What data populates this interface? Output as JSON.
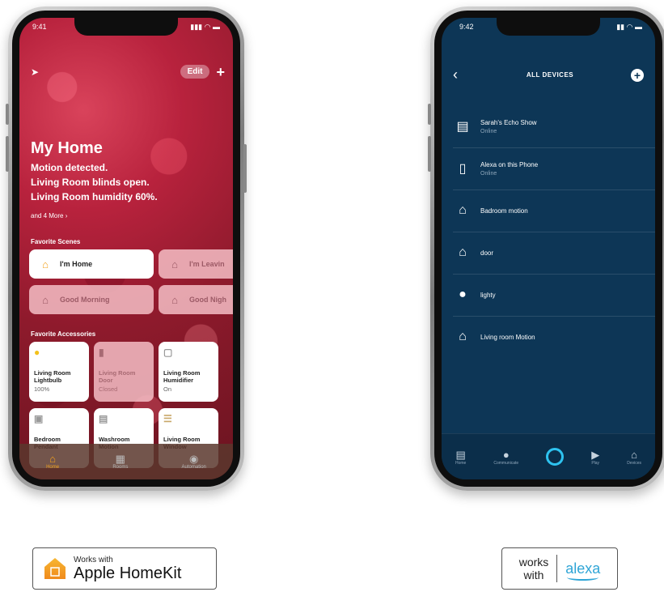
{
  "homekit": {
    "status_time": "9:41",
    "status_icons": "▮▮▮ ◠ ▬",
    "location_icon": "location-arrow-icon",
    "edit_label": "Edit",
    "add_label": "+",
    "title": "My Home",
    "messages": [
      "Motion detected.",
      "Living Room blinds open.",
      "Living Room humidity 60%."
    ],
    "more": "and 4 More ›",
    "scenes_header": "Favorite Scenes",
    "scenes": [
      {
        "label": "I'm Home",
        "icon": "home-person-icon",
        "active": true
      },
      {
        "label": "I'm Leavin",
        "icon": "home-leaving-icon",
        "active": false
      },
      {
        "label": "Good Morning",
        "icon": "sunrise-house-icon",
        "active": false
      },
      {
        "label": "Good Nigh",
        "icon": "moon-house-icon",
        "active": false
      }
    ],
    "accessories_header": "Favorite Accessories",
    "accessories": [
      {
        "name": "Living Room Lightbulb",
        "state": "100%",
        "icon": "lightbulb-icon",
        "on": true
      },
      {
        "name": "Living Room Door",
        "state": "Closed",
        "icon": "door-icon",
        "on": false
      },
      {
        "name": "Living Room Humidifier",
        "state": "On",
        "icon": "humidifier-icon",
        "on": true
      },
      {
        "name": "Bedroom Pendant",
        "state": "",
        "icon": "pendant-lamp-icon",
        "on": true
      },
      {
        "name": "Washroom Motion",
        "state": "",
        "icon": "motion-sensor-icon",
        "on": true
      },
      {
        "name": "Living Room Window",
        "state": "",
        "icon": "blinds-icon",
        "on": true
      }
    ],
    "tabs": [
      {
        "label": "Home",
        "icon": "house-icon",
        "selected": true
      },
      {
        "label": "Rooms",
        "icon": "rooms-icon",
        "selected": false
      },
      {
        "label": "Automation",
        "icon": "automation-icon",
        "selected": false
      }
    ]
  },
  "alexa": {
    "status_time": "9:42",
    "status_icons": "▮▮ ◠ ▬",
    "title": "ALL DEVICES",
    "devices": [
      {
        "name": "Sarah's Echo Show",
        "sub": "Online",
        "icon": "echo-show-icon"
      },
      {
        "name": "Alexa on this Phone",
        "sub": "Online",
        "icon": "phone-icon"
      },
      {
        "name": "Badroom motion",
        "sub": "",
        "icon": "motion-sensor-icon"
      },
      {
        "name": "door",
        "sub": "",
        "icon": "motion-sensor-icon"
      },
      {
        "name": "lighty",
        "sub": "",
        "icon": "lightbulb-icon"
      },
      {
        "name": "Living room Motion",
        "sub": "",
        "icon": "motion-sensor-icon"
      }
    ],
    "tabs": [
      {
        "label": "Home",
        "icon": "home-icon"
      },
      {
        "label": "Communicate",
        "icon": "chat-icon"
      },
      {
        "label": "",
        "icon": "alexa-ring-icon"
      },
      {
        "label": "Play",
        "icon": "play-icon"
      },
      {
        "label": "Devices",
        "icon": "devices-icon"
      }
    ]
  },
  "badges": {
    "homekit_small": "Works with",
    "homekit_big": "Apple HomeKit",
    "alexa_works": "works",
    "alexa_with": "with",
    "alexa_brand": "alexa"
  },
  "colors": {
    "homekit_accent": "#f3a21c",
    "alexa_background": "#0d3656",
    "alexa_ring": "#2ec3f0",
    "alexa_brand": "#2fa5d6"
  }
}
